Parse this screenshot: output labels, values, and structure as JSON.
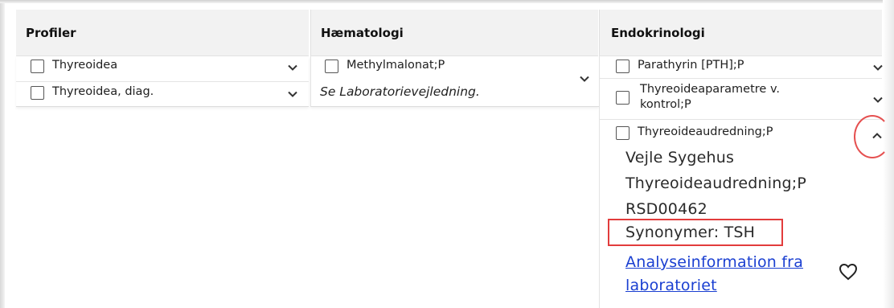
{
  "columns": {
    "profiler": {
      "title": "Profiler",
      "items": [
        {
          "label": "Thyreoidea"
        },
        {
          "label": "Thyreoidea, diag."
        }
      ]
    },
    "haematologi": {
      "title": "Hæmatologi",
      "items": [
        {
          "label": "Methylmalonat;P",
          "note": "Se Laboratorievejledning."
        }
      ]
    },
    "endokrinologi": {
      "title": "Endokrinologi",
      "items": [
        {
          "label": "Parathyrin [PTH];P"
        },
        {
          "label": "Thyreoideaparametre v. kontrol;P",
          "label_line1": "Thyreoideaparametre v.",
          "label_line2": "kontrol;P"
        },
        {
          "label": "Thyreoideaudredning;P",
          "expanded": true
        }
      ],
      "details": {
        "hospital": "Vejle Sygehus",
        "name": "Thyreoideaudredning;P",
        "code": "RSD00462",
        "synonyms": "Synonymer: TSH",
        "link_line1": "Analyseinformation fra",
        "link_line2": "laboratoriet"
      }
    }
  },
  "icons": {
    "chevron_down": "chevron-down-icon",
    "chevron_up": "chevron-up-icon",
    "favorite": "heart-icon"
  },
  "colors": {
    "header_bg": "#f2f2f2",
    "link": "#1a3fd1",
    "highlight_red": "#e23c3c"
  }
}
